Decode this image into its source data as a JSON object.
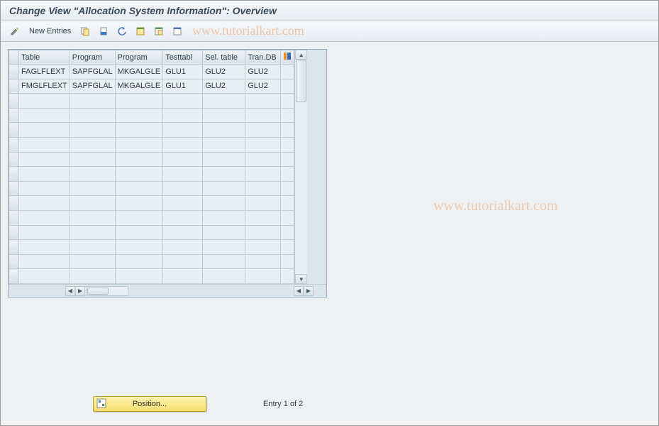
{
  "title": "Change View \"Allocation System Information\": Overview",
  "toolbar": {
    "new_entries_label": "New Entries"
  },
  "watermark": "www.tutorialkart.com",
  "table": {
    "headers": [
      "Table",
      "Program",
      "Program",
      "Testtabl",
      "Sel. table",
      "Tran.DB"
    ],
    "rows": [
      [
        "FAGLFLEXT",
        "SAPFGLAL",
        "MKGALGLE",
        "GLU1",
        "GLU2",
        "GLU2"
      ],
      [
        "FMGLFLEXT",
        "SAPFGLAL",
        "MKGALGLE",
        "GLU1",
        "GLU2",
        "GLU2"
      ]
    ],
    "empty_rows": 13
  },
  "footer": {
    "position_label": "Position...",
    "entry_text": "Entry 1 of 2"
  }
}
